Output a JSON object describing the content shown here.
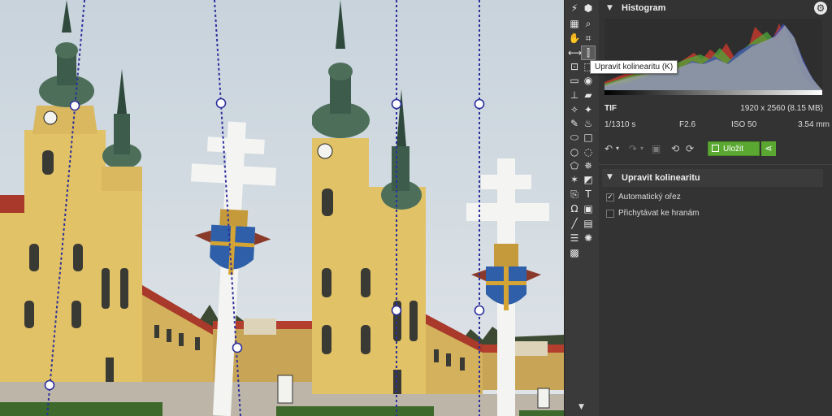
{
  "tools": [
    {
      "icon": "lightning-icon",
      "glyph": "⚡"
    },
    {
      "icon": "cube-icon",
      "glyph": "⬢"
    },
    {
      "icon": "grid-icon",
      "glyph": "▦"
    },
    {
      "icon": "zoom-icon",
      "glyph": "⌕"
    },
    {
      "icon": "hand-icon",
      "glyph": "✋"
    },
    {
      "icon": "crop-icon",
      "glyph": "⌗"
    },
    {
      "icon": "straighten-icon",
      "glyph": "⟷"
    },
    {
      "icon": "collinearity-icon",
      "glyph": "⫿"
    },
    {
      "icon": "transform-icon",
      "glyph": "⊡"
    },
    {
      "icon": "perspective-icon",
      "glyph": "⬚"
    },
    {
      "icon": "levels-icon",
      "glyph": "▭"
    },
    {
      "icon": "eye-icon",
      "glyph": "◉"
    },
    {
      "icon": "stamp-icon",
      "glyph": "⊥"
    },
    {
      "icon": "eraser-icon",
      "glyph": "▰"
    },
    {
      "icon": "wand-icon",
      "glyph": "✧"
    },
    {
      "icon": "healing-icon",
      "glyph": "✦"
    },
    {
      "icon": "brush-icon",
      "glyph": "✎"
    },
    {
      "icon": "bucket-icon",
      "glyph": "♨"
    },
    {
      "icon": "rubber-icon",
      "glyph": "⬭"
    },
    {
      "icon": "rectangle-select-icon",
      "glyph": "□"
    },
    {
      "icon": "ellipse-select-icon",
      "glyph": "○"
    },
    {
      "icon": "lasso-icon",
      "glyph": "◌"
    },
    {
      "icon": "polygon-select-icon",
      "glyph": "⬠"
    },
    {
      "icon": "magic-select-icon",
      "glyph": "✵"
    },
    {
      "icon": "sparkle-select-icon",
      "glyph": "✶"
    },
    {
      "icon": "gradient-select-icon",
      "glyph": "◩"
    },
    {
      "icon": "paste-icon",
      "glyph": "⎘"
    },
    {
      "icon": "text-icon",
      "glyph": "T"
    },
    {
      "icon": "symbol-icon",
      "glyph": "Ω"
    },
    {
      "icon": "image-icon",
      "glyph": "▣"
    },
    {
      "icon": "line-icon",
      "glyph": "╱"
    },
    {
      "icon": "note-icon",
      "glyph": "▤"
    },
    {
      "icon": "lines-icon",
      "glyph": "☰"
    },
    {
      "icon": "effects-icon",
      "glyph": "✺"
    },
    {
      "icon": "frame-icon",
      "glyph": "▩"
    }
  ],
  "tooltip": "Upravit kolinearitu (K)",
  "histogram": {
    "title": "Histogram"
  },
  "file": {
    "format": "TIF",
    "dimensions": "1920 x 2560 (8.15 MB)",
    "shutter": "1/1310 s",
    "aperture": "F2.6",
    "iso": "ISO 50",
    "focal": "3.54 mm"
  },
  "actions": {
    "save_label": "Uložit"
  },
  "collinearity": {
    "title": "Upravit kolinearitu",
    "options": [
      {
        "label": "Automatický ořez",
        "checked": true
      },
      {
        "label": "Přichytávat ke hranám",
        "checked": false
      }
    ]
  },
  "colors": {
    "accent": "#5aa832",
    "guide": "#2c2f9c"
  }
}
